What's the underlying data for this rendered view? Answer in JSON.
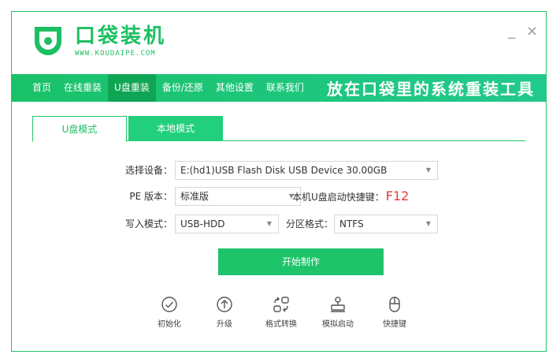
{
  "window": {
    "brand_title": "口袋装机",
    "brand_url": "WWW.KOUDAIPE.COM",
    "min_symbol": "_",
    "close_symbol": "×"
  },
  "nav": {
    "items": [
      {
        "label": "首页"
      },
      {
        "label": "在线重装"
      },
      {
        "label": "U盘重装"
      },
      {
        "label": "备份/还原"
      },
      {
        "label": "其他设置"
      },
      {
        "label": "联系我们"
      }
    ],
    "active_index": 2,
    "slogan": "放在口袋里的系统重装工具"
  },
  "tabs": [
    {
      "label": "U盘模式"
    },
    {
      "label": "本地模式"
    }
  ],
  "form": {
    "device": {
      "label": "选择设备：",
      "value": "E:(hd1)USB Flash Disk USB Device 30.00GB"
    },
    "pe_version": {
      "label": "PE 版本：",
      "value": "标准版"
    },
    "hotkey": {
      "label": "本机U盘启动快捷键：",
      "value": "F12"
    },
    "write_mode": {
      "label": "写入模式：",
      "value": "USB-HDD"
    },
    "partition": {
      "label": "分区格式：",
      "value": "NTFS"
    }
  },
  "start_button": "开始制作",
  "tools": [
    {
      "label": "初始化",
      "icon": "check-circle-icon"
    },
    {
      "label": "升级",
      "icon": "arrow-up-circle-icon"
    },
    {
      "label": "格式转换",
      "icon": "convert-icon"
    },
    {
      "label": "模拟启动",
      "icon": "simulate-boot-icon"
    },
    {
      "label": "快捷键",
      "icon": "mouse-icon"
    }
  ],
  "colors": {
    "accent": "#1dc46a",
    "nav_active": "#0fa554",
    "hotkey": "#e53935",
    "border": "#1fc46a"
  }
}
